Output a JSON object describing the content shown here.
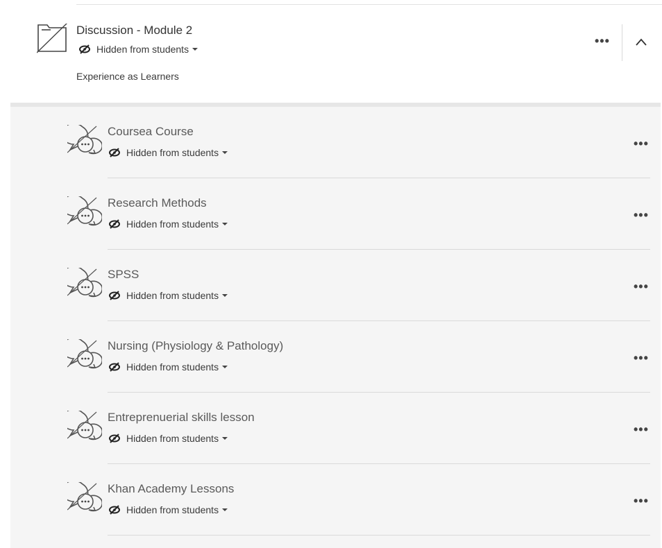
{
  "folder": {
    "title": "Discussion - Module 2",
    "visibility": "Hidden from students",
    "description": "Experience as Learners",
    "more_label": "•••",
    "icons": {
      "folder": "folder-hidden-icon",
      "eye": "eye-slash-icon",
      "collapse": "chevron-up-icon"
    }
  },
  "items": [
    {
      "title": "Coursea Course",
      "visibility": "Hidden from students",
      "more_label": "•••",
      "icon": "discussion-hidden-icon"
    },
    {
      "title": "Research Methods",
      "visibility": "Hidden from students",
      "more_label": "•••",
      "icon": "discussion-hidden-icon"
    },
    {
      "title": "SPSS",
      "visibility": "Hidden from students",
      "more_label": "•••",
      "icon": "discussion-hidden-icon"
    },
    {
      "title": "Nursing (Physiology & Pathology)",
      "visibility": "Hidden from students",
      "more_label": "•••",
      "icon": "discussion-hidden-icon"
    },
    {
      "title": "Entreprenuerial skills lesson",
      "visibility": "Hidden from students",
      "more_label": "•••",
      "icon": "discussion-hidden-icon"
    },
    {
      "title": "Khan Academy Lessons",
      "visibility": "Hidden from students",
      "more_label": "•••",
      "icon": "discussion-hidden-icon"
    }
  ]
}
